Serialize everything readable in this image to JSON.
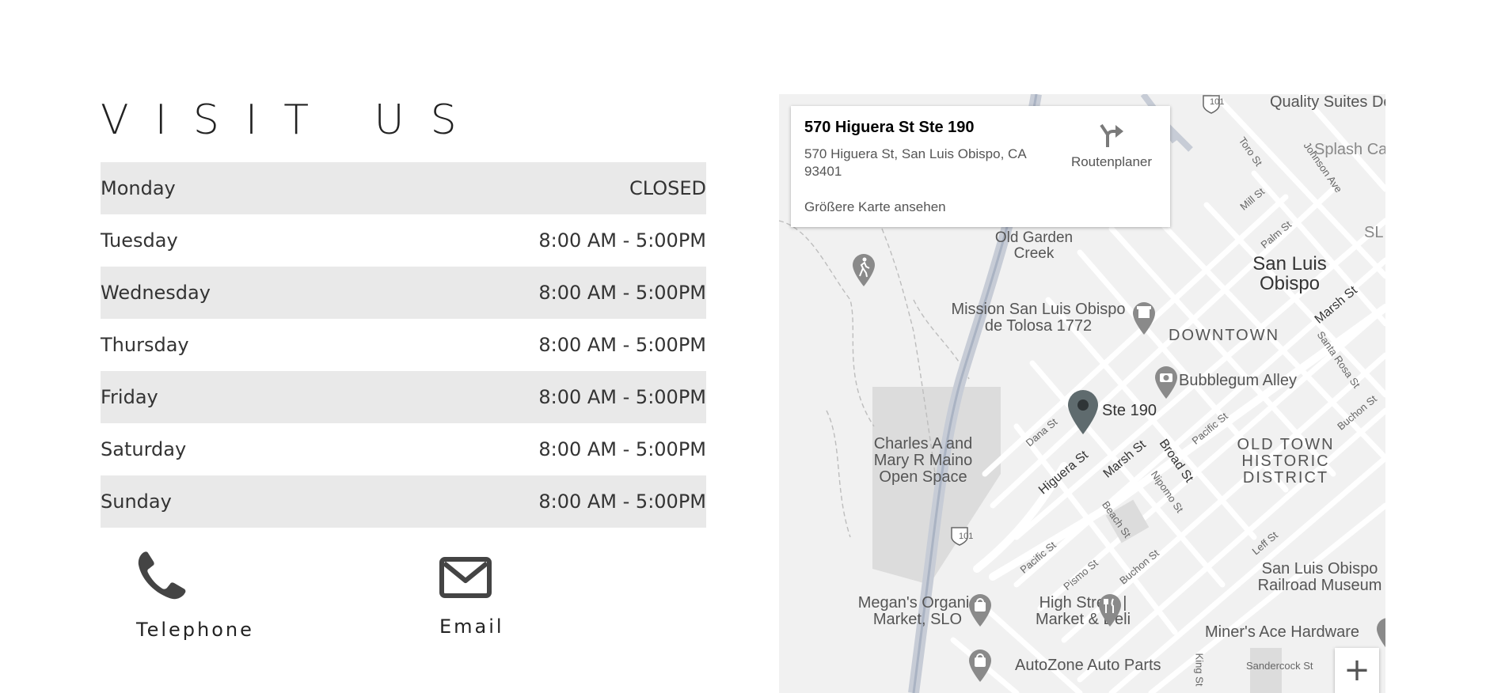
{
  "section_title": "VISIT US",
  "hours": [
    {
      "day": "Monday",
      "time": "CLOSED"
    },
    {
      "day": "Tuesday",
      "time": "8:00 AM - 5:00PM"
    },
    {
      "day": "Wednesday",
      "time": "8:00 AM - 5:00PM"
    },
    {
      "day": "Thursday",
      "time": "8:00 AM - 5:00PM"
    },
    {
      "day": "Friday",
      "time": "8:00 AM - 5:00PM"
    },
    {
      "day": "Saturday",
      "time": "8:00 AM - 5:00PM"
    },
    {
      "day": "Sunday",
      "time": "8:00 AM - 5:00PM"
    }
  ],
  "contact": {
    "telephone_label": "Telephone",
    "telephone_icon": "phone-icon",
    "email_label": "Email",
    "email_icon": "envelope-icon"
  },
  "map": {
    "info_card": {
      "name": "570 Higuera St Ste 190",
      "address": "570 Higuera St, San Luis Obispo, CA 93401",
      "larger_map_link": "Größere Karte ansehen",
      "directions_label": "Routenplaner"
    },
    "marker_label": "Ste 190",
    "zoom_in_label": "+",
    "places": {
      "quality_suites": "Quality Suites Do San Lu",
      "splash": "Splash Ca",
      "old_garden_creek": "Old Garden Creek",
      "san_luis_obispo": "San Luis Obispo",
      "mission": "Mission San Luis Obispo de Tolosa 1772",
      "downtown": "DOWNTOWN",
      "bubblegum": "Bubblegum Alley",
      "charles_maino": "Charles A and Mary R Maino Open Space",
      "old_town": "OLD TOWN HISTORIC DISTRICT",
      "megans": "Megan's Organic Market, SLO",
      "high_street": "High Street | Market & Deli",
      "railroad_museum": "San Luis Obispo Railroad Museum",
      "miners": "Miner's Ace Hardware",
      "autozone": "AutoZone Auto Parts",
      "slo_partial": "SL"
    },
    "streets": {
      "toro": "Toro St",
      "johnson": "Johnson Ave",
      "mill": "Mill St",
      "palm": "Palm St",
      "marsh_ne": "Marsh St",
      "santa_rosa": "Santa Rosa St",
      "buchon_e": "Buchon St",
      "dana": "Dana St",
      "higuera": "Higuera St",
      "marsh": "Marsh St",
      "broad": "Broad St",
      "nipomo": "Nipomo St",
      "pacific": "Pacific St",
      "beach": "Beach St",
      "pacific_s": "Pacific St",
      "pismo": "Pismo St",
      "buchon": "Buchon St",
      "leff": "Leff St",
      "king": "King St",
      "sandercock": "Sandercock St",
      "hwy_101": "101"
    }
  }
}
